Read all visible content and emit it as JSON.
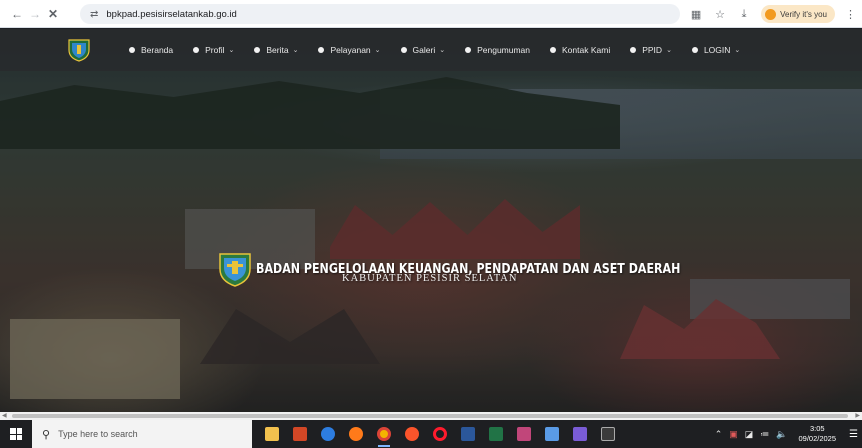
{
  "browser": {
    "url": "bpkpad.pesisirselatankab.go.id",
    "verify_label": "Verify it's you"
  },
  "site": {
    "menu": [
      {
        "label": "Beranda",
        "dropdown": false
      },
      {
        "label": "Profil",
        "dropdown": true
      },
      {
        "label": "Berita",
        "dropdown": true
      },
      {
        "label": "Pelayanan",
        "dropdown": true
      },
      {
        "label": "Galeri",
        "dropdown": true
      },
      {
        "label": "Pengumuman",
        "dropdown": false
      },
      {
        "label": "Kontak Kami",
        "dropdown": false
      },
      {
        "label": "PPID",
        "dropdown": true
      },
      {
        "label": "LOGIN",
        "dropdown": true
      }
    ],
    "hero_title": "BADAN PENGELOLAAN KEUANGAN, PENDAPATAN DAN ASET DAERAH",
    "hero_subtitle": "KABUPATEN PESISIR SELATAN"
  },
  "taskbar": {
    "search_placeholder": "Type here to search",
    "time": "3:05",
    "date": "09/02/2025"
  },
  "colors": {
    "navbar": "#2a2c2e",
    "taskbar": "#1e1f22",
    "accent": "#f29a1f"
  },
  "icons": {
    "back": "arrow-left-icon",
    "forward": "arrow-right-icon",
    "reload": "close-icon",
    "site_info": "tune-icon",
    "translate": "translate-icon",
    "bookmark": "star-icon",
    "download": "download-icon",
    "menu": "kebab-icon"
  }
}
